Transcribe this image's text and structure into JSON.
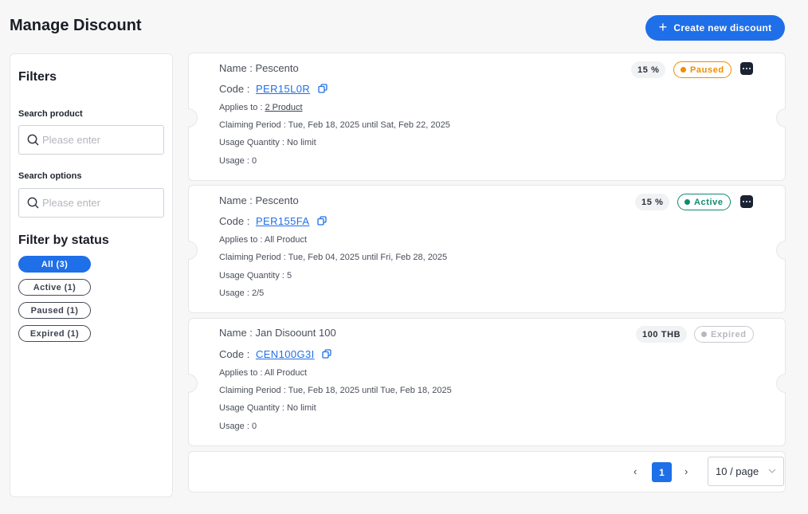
{
  "header": {
    "title": "Manage Discount",
    "create_button": "Create new discount"
  },
  "filters": {
    "title": "Filters",
    "search_product_label": "Search product",
    "search_product_placeholder": "Please enter",
    "search_options_label": "Search options",
    "search_options_placeholder": "Please enter",
    "status_title": "Filter by status",
    "statuses": [
      {
        "label": "All (3)",
        "selected": true
      },
      {
        "label": "Active (1)",
        "selected": false
      },
      {
        "label": "Paused (1)",
        "selected": false
      },
      {
        "label": "Expired (1)",
        "selected": false
      }
    ]
  },
  "discounts": [
    {
      "name": "Name : Pescento",
      "code_prefix": "Code :",
      "code": "PER15L0R",
      "applies_prefix": "Applies to :",
      "applies": "2 Product",
      "claiming_period": "Claiming Period : Tue, Feb 18, 2025 until Sat, Feb 22, 2025",
      "usage_quantity": "Usage Quantity : No limit",
      "usage": "Usage : 0",
      "value": "15 %",
      "status": "Paused",
      "status_color": "#f08c00"
    },
    {
      "name": "Name : Pescento",
      "code_prefix": "Code :",
      "code": "PER155FA",
      "applies_prefix": "Applies to :",
      "applies": "All Product",
      "claiming_period": "Claiming Period : Tue, Feb 04, 2025 until Fri, Feb 28, 2025",
      "usage_quantity": "Usage Quantity : 5",
      "usage": "Usage : 2/5",
      "value": "15 %",
      "status": "Active",
      "status_color": "#0f8a6e"
    },
    {
      "name": "Name : Jan Disoount 100",
      "code_prefix": "Code :",
      "code": "CEN100G3I",
      "applies_prefix": "Applies to :",
      "applies": "All Product",
      "claiming_period": "Claiming Period : Tue, Feb 18, 2025 until Tue, Feb 18, 2025",
      "usage_quantity": "Usage Quantity : No limit",
      "usage": "Usage : 0",
      "value": "100 THB",
      "status": "Expired",
      "status_color": "#b5b8be"
    }
  ],
  "pagination": {
    "current_page": "1",
    "page_size": "10 / page"
  },
  "colors": {
    "accent": "#1f6fe8"
  }
}
